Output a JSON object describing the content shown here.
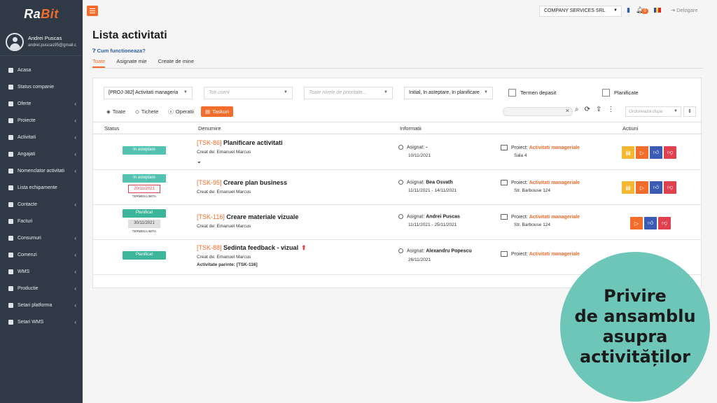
{
  "brand": {
    "logo_main": "Ra",
    "logo_accent": "Bit"
  },
  "user": {
    "name": "Andrei Puscas",
    "email": "andrei.puscas95@gmail.c"
  },
  "sidebar": {
    "items": [
      {
        "label": "Acasa",
        "icon": "home-icon",
        "submenu": false
      },
      {
        "label": "Status companie",
        "icon": "chart-icon",
        "submenu": false
      },
      {
        "label": "Oferte",
        "icon": "file-icon",
        "submenu": true
      },
      {
        "label": "Proiecte",
        "icon": "file-icon",
        "submenu": true
      },
      {
        "label": "Activitati",
        "icon": "diamond-icon",
        "submenu": true
      },
      {
        "label": "Angajati",
        "icon": "person-icon",
        "submenu": true
      },
      {
        "label": "Nomenclator activitati",
        "icon": "grid-icon",
        "submenu": true
      },
      {
        "label": "Lista echipamente",
        "icon": "list-icon",
        "submenu": false
      },
      {
        "label": "Contacte",
        "icon": "card-icon",
        "submenu": true
      },
      {
        "label": "Facturi",
        "icon": "money-icon",
        "submenu": false
      },
      {
        "label": "Consumuri",
        "icon": "cart-icon",
        "submenu": true
      },
      {
        "label": "Comenzi",
        "icon": "grid-icon",
        "submenu": true
      },
      {
        "label": "WMS",
        "icon": "grid-icon",
        "submenu": true
      },
      {
        "label": "Productie",
        "icon": "grid-icon",
        "submenu": true
      },
      {
        "label": "Setari platforma",
        "icon": "wrench-icon",
        "submenu": true
      },
      {
        "label": "Setari WMS",
        "icon": "gear-icon",
        "submenu": true
      }
    ]
  },
  "topbar": {
    "company": "COMPANY SERVICES SRL",
    "notifications": "0",
    "logout": "Delogare"
  },
  "page": {
    "title": "Lista activitati",
    "help": "Cum functioneaza?"
  },
  "tabs": [
    {
      "label": "Toate",
      "active": true
    },
    {
      "label": "Asignate mie",
      "active": false
    },
    {
      "label": "Create de mine",
      "active": false
    }
  ],
  "filters": {
    "project": "[PROJ-382] Activitati manageria",
    "users_placeholder": "Toti userii",
    "priority_placeholder": "Toate nivele de prioritate...",
    "status": "Initial, In asteptare, In planificare",
    "overdue": "Termen depasit",
    "planned": "Planificate"
  },
  "type_buttons": [
    {
      "label": "Toate",
      "active": false
    },
    {
      "label": "Tichete",
      "active": false
    },
    {
      "label": "Operatii",
      "active": false
    },
    {
      "label": "Taskuri",
      "active": true
    }
  ],
  "order": {
    "placeholder": "Ordoneaza dupa"
  },
  "columns": {
    "status": "Status",
    "name": "Denumire",
    "info": "Informatii",
    "actions": "Actiuni"
  },
  "rows": [
    {
      "status": "In asteptare",
      "deadline": "",
      "deadline_label": "",
      "code": "[TSK-86]",
      "title": "Planificare activitati",
      "creator": "Creat de: Emanuel Marcus",
      "parent": "",
      "assignee_label": "Asignat:",
      "assignee": "-",
      "dates": "10/11/2021",
      "project_label": "Proiect:",
      "project": "Activitati manageriale",
      "location": "Sala 4"
    },
    {
      "status": "In asteptare",
      "deadline": "20/11/2021",
      "deadline_label": "TERMEN LIMITA",
      "code": "[TSK-95]",
      "title": "Creare plan business",
      "creator": "Creat de: Emanuel Marcus",
      "parent": "",
      "assignee_label": "Asignat:",
      "assignee": "Bea Osvath",
      "dates": "11/11/2021 - 14/11/2021",
      "project_label": "Proiect:",
      "project": "Activitati manageriale",
      "location": "Str. Barbouse 124"
    },
    {
      "status": "Planificat",
      "deadline": "30/11/2021",
      "deadline_label": "TERMEN LIMITA",
      "code": "[TSK-116]",
      "title": "Creare materiale vizuale",
      "creator": "Creat de: Emanuel Marcus",
      "parent": "",
      "assignee_label": "Asignat:",
      "assignee": "Andrei Puscas",
      "dates": "11/11/2021 - 25/11/2021",
      "project_label": "Proiect:",
      "project": "Activitati manageriale",
      "location": "Str. Barbouse 124"
    },
    {
      "status": "Planificat",
      "deadline": "",
      "deadline_label": "",
      "code": "[TSK-88]",
      "title": "Sedinta feedback - vizual",
      "creator": "Creat de: Emanuel Marcus",
      "parent": "Activitate parinte: [TSK-116]",
      "assignee_label": "Asignat:",
      "assignee": "Alexandru Popescu",
      "dates": "26/11/2021",
      "project_label": "Proiect:",
      "project": "Activitati manageriale",
      "location": ""
    }
  ],
  "promo": {
    "line1": "Privire",
    "line2": "de ansamblu",
    "line3": "asupra",
    "line4": "activităților"
  },
  "colors": {
    "accent": "#f26c2b",
    "sidebar": "#2f3a46",
    "status_waiting": "#53c2b3",
    "status_planned": "#3cb59a",
    "promo": "#6dc6b7"
  }
}
